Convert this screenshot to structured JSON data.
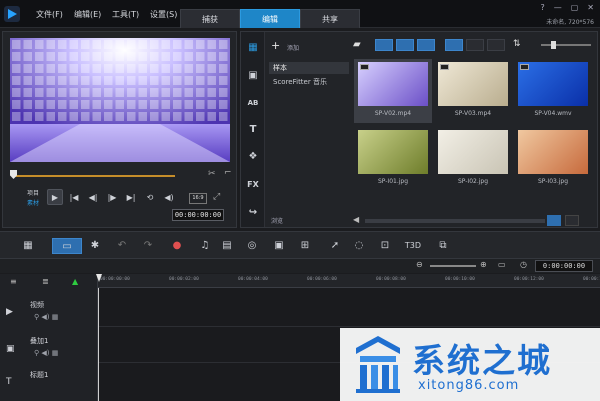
{
  "menubar": {
    "items": [
      "文件(F)",
      "编辑(E)",
      "工具(T)",
      "设置(S)"
    ],
    "tabs": [
      "捕获",
      "编辑",
      "共享"
    ],
    "active_tab": 1,
    "window_controls": [
      "?",
      "—",
      "▢",
      "✕"
    ],
    "project_info": "未命名, 720*576"
  },
  "player": {
    "mode_project": "项目",
    "mode_clip": "素材",
    "resolution": "16:9",
    "timecode": "00:00:00:00",
    "progress": 0.73
  },
  "library": {
    "add_label": "添加",
    "folders": [
      {
        "label": "样本",
        "selected": true
      },
      {
        "label": "ScoreFitter 音乐",
        "selected": false
      }
    ],
    "browse_label": "浏览",
    "side_tools": [
      "media-icon",
      "instant-project-icon",
      "transition-icon",
      "title-icon",
      "graphics-icon",
      "filter-icon",
      "path-icon"
    ],
    "side_glyphs": [
      "▦",
      "▣",
      "AB",
      "T",
      "❖",
      "FX",
      "↪"
    ],
    "thumbnails": [
      {
        "caption": "SP-V02.mp4",
        "selected": true,
        "kind": "video",
        "color_a": "#6b4fc7",
        "color_b": "#d7d0ff"
      },
      {
        "caption": "SP-V03.mp4",
        "selected": false,
        "kind": "video",
        "color_a": "#b9ad8e",
        "color_b": "#efe8d6"
      },
      {
        "caption": "SP-V04.wmv",
        "selected": false,
        "kind": "video",
        "color_a": "#0a2fa8",
        "color_b": "#2b6fe6"
      },
      {
        "caption": "SP-I01.jpg",
        "selected": false,
        "kind": "image",
        "color_a": "#6e7d2a",
        "color_b": "#c8d08a"
      },
      {
        "caption": "SP-I02.jpg",
        "selected": false,
        "kind": "image",
        "color_a": "#c9c4b4",
        "color_b": "#f2efe6"
      },
      {
        "caption": "SP-I03.jpg",
        "selected": false,
        "kind": "image",
        "color_a": "#c76a3c",
        "color_b": "#f0c8a0"
      }
    ]
  },
  "timeline": {
    "timecode": "0:00:00:00",
    "ruler": [
      "00:00:00:00",
      "00:00:02:00",
      "00:00:04:00",
      "00:00:06:00",
      "00:00:08:00",
      "00:00:10:00",
      "00:00:12:00",
      "00:00:14:00"
    ],
    "tracks": [
      {
        "label": "视频",
        "icon": "▶"
      },
      {
        "label": "叠加1",
        "icon": "▣"
      },
      {
        "label": "标题1",
        "icon": "T"
      }
    ]
  },
  "watermark": {
    "title": "系统之城",
    "url": "xitong86.com"
  },
  "colors": {
    "accent": "#1e86c8",
    "background": "#1b1c1f",
    "watermark": "#1f6fd0"
  }
}
